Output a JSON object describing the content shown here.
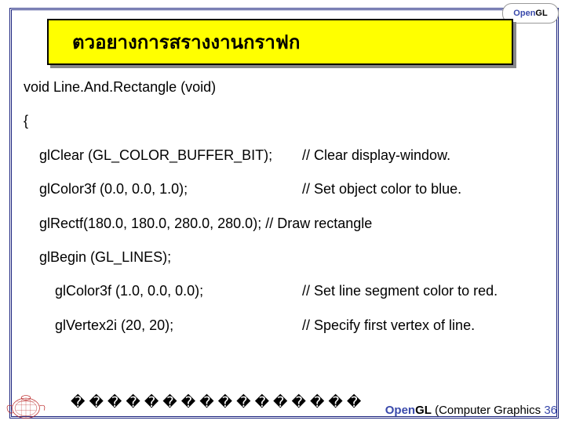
{
  "logo": {
    "open": "Open",
    "gl": "GL"
  },
  "header": "ตวอยางการสรางงานกราฟก",
  "code": {
    "sig": "void Line.And.Rectangle (void)",
    "brace": "{",
    "l1_code": "glClear (GL_COLOR_BUFFER_BIT);",
    "l1_comment": "// Clear display-window.",
    "l2_code": "glColor3f (0.0, 0.0, 1.0);",
    "l2_comment": "// Set object color to blue.",
    "l3_full": "glRectf(180.0, 180.0, 280.0, 280.0); // Draw rectangle",
    "l4_code": "glBegin (GL_LINES);",
    "l5_code": "glColor3f (1.0, 0.0, 0.0);",
    "l5_comment": "// Set line segment color to red.",
    "l6_code": "glVertex2i (20, 20);",
    "l6_comment": "// Specify first vertex of line."
  },
  "footer_squares": "����������������",
  "footer": {
    "open": "Open",
    "gl": "GL",
    "text": " (Computer Graphics ",
    "page": "36"
  }
}
